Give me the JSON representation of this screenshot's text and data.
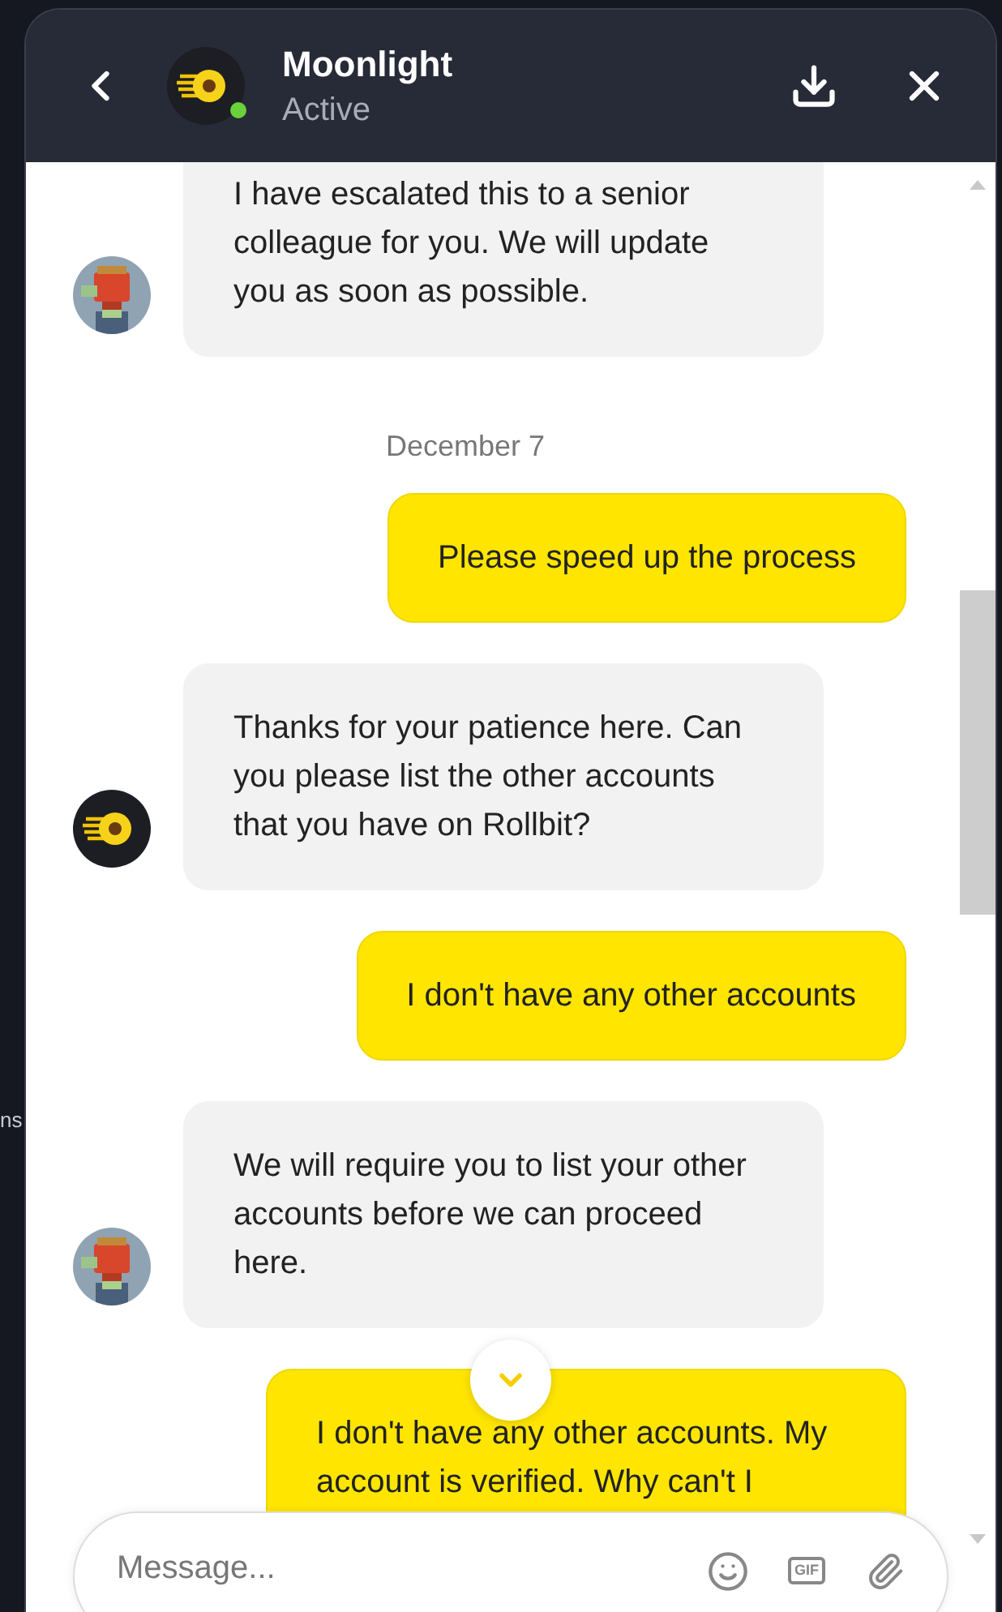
{
  "background_text": [
    "ns"
  ],
  "header": {
    "title": "Moonlight",
    "status": "Active",
    "online": true
  },
  "messages": [
    {
      "kind": "agent",
      "text": "I have escalated this to a senior colleague for you. We will update you as soon as possible."
    },
    {
      "kind": "date",
      "text": "December 7"
    },
    {
      "kind": "outgoing",
      "text": "Please speed up the process"
    },
    {
      "kind": "support",
      "text": "Thanks for your patience here. Can you please list the other accounts that you have on Rollbit?"
    },
    {
      "kind": "outgoing",
      "text": "I don't have any other accounts"
    },
    {
      "kind": "agent",
      "text": "We will require you to list your other accounts before we can proceed here."
    },
    {
      "kind": "outgoing",
      "text": "I don't have any other accounts. My account is verified. Why can't I"
    }
  ],
  "composer": {
    "placeholder": "Message...",
    "gif_label": "GIF"
  }
}
